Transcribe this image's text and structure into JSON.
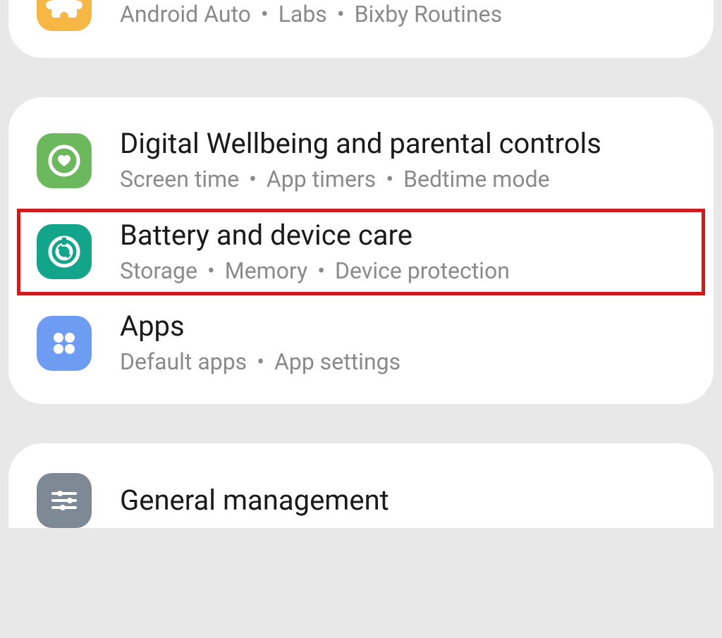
{
  "group0": {
    "advanced": {
      "title": "",
      "sub": [
        "Android Auto",
        "Labs",
        "Bixby Routines"
      ],
      "icon": "puzzle-icon",
      "color": "bg-orange"
    }
  },
  "group1": {
    "wellbeing": {
      "title": "Digital Wellbeing and parental controls",
      "sub": [
        "Screen time",
        "App timers",
        "Bedtime mode"
      ],
      "icon": "heart-circle-icon",
      "color": "bg-green"
    },
    "battery": {
      "title": "Battery and device care",
      "sub": [
        "Storage",
        "Memory",
        "Device protection"
      ],
      "icon": "device-care-icon",
      "color": "bg-teal",
      "highlighted": true
    },
    "apps": {
      "title": "Apps",
      "sub": [
        "Default apps",
        "App settings"
      ],
      "icon": "apps-grid-icon",
      "color": "bg-blue"
    }
  },
  "group2": {
    "general": {
      "title": "General management",
      "sub": [],
      "icon": "sliders-icon",
      "color": "bg-gray"
    }
  }
}
